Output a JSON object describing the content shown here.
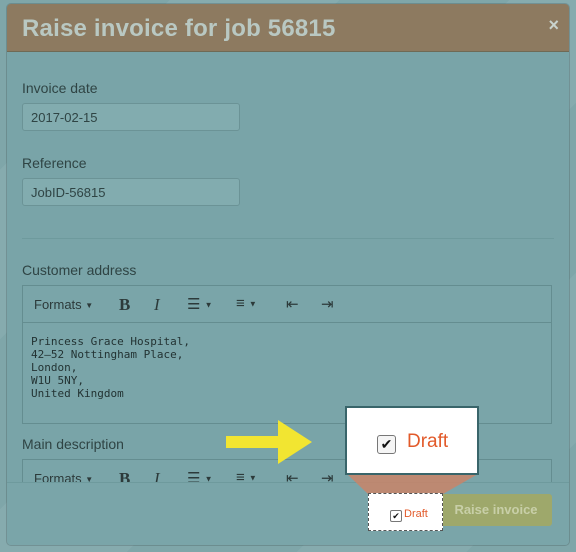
{
  "modal": {
    "title": "Raise invoice for job 56815",
    "close_label": "×"
  },
  "form": {
    "invoice_date_label": "Invoice date",
    "invoice_date_value": "2017-02-15",
    "reference_label": "Reference",
    "reference_value": "JobID-56815",
    "customer_address_label": "Customer address",
    "customer_address_value": "Princess Grace Hospital,\n42–52 Nottingham Place,\nLondon,\nW1U 5NY,\nUnited Kingdom",
    "main_description_label": "Main description"
  },
  "toolbar": {
    "formats_label": "Formats",
    "bold_label": "B",
    "italic_label": "I"
  },
  "footer": {
    "draft_label": "Draft",
    "raise_label": "Raise invoice"
  },
  "callout": {
    "draft_label": "Draft"
  },
  "colors": {
    "accent_draft": "#e25a2a",
    "arrow": "#f2e531",
    "raise_button": "#9ea86b"
  },
  "icons": [
    "close-icon",
    "bullet-list-icon",
    "numbered-list-icon",
    "outdent-icon",
    "indent-icon",
    "checkbox-checked-icon",
    "arrow-right-icon"
  ]
}
